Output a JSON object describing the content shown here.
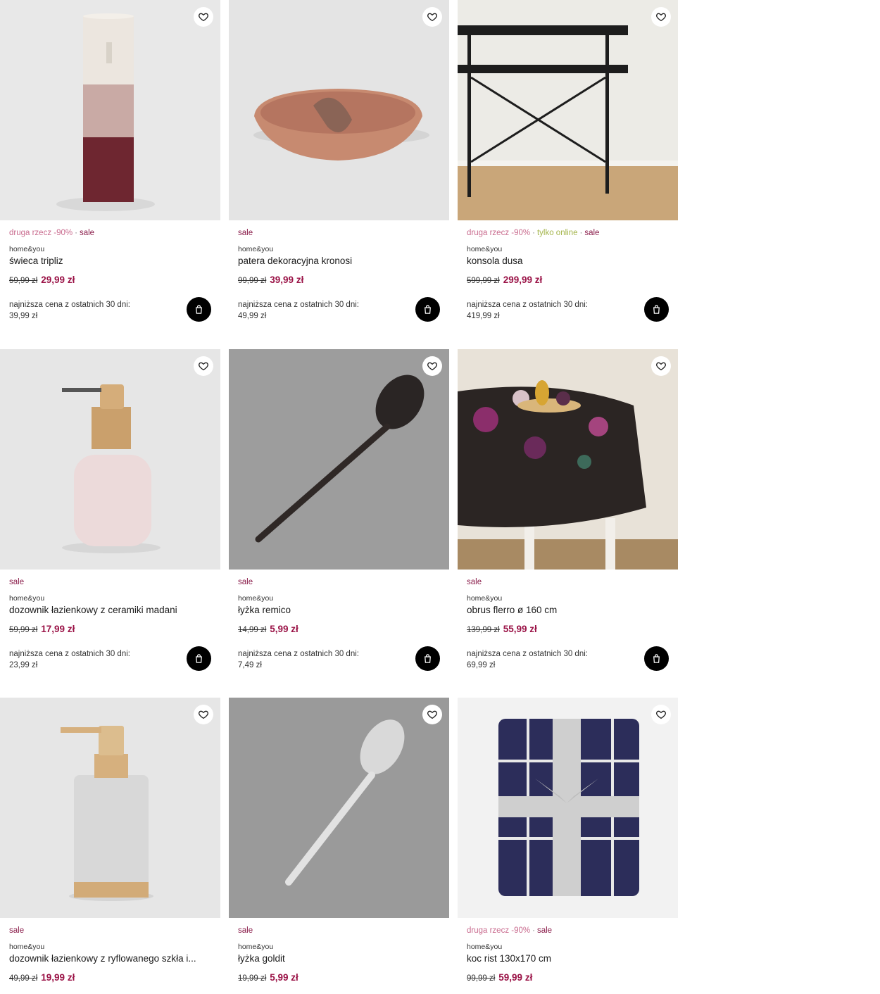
{
  "common": {
    "brand": "home&you",
    "lowest_label": "najniższa cena z ostatnich 30 dni:",
    "sep": "·",
    "colors": {
      "promo": "#c96b8e",
      "online": "#a4b54b",
      "sale": "#8a1c4a",
      "price_new": "#9a1246"
    },
    "icons": {
      "favorite": "heart-outline-icon",
      "cart": "shopping-bag-icon"
    }
  },
  "products": [
    {
      "promo": "druga rzecz -90%",
      "online": "",
      "sale": "sale",
      "brand": "home&you",
      "name": "świeca tripliz",
      "old_price": "59,99 zł",
      "new_price": "29,99 zł",
      "lowest_price": "39,99 zł"
    },
    {
      "promo": "",
      "online": "",
      "sale": "sale",
      "brand": "home&you",
      "name": "patera dekoracyjna kronosi",
      "old_price": "99,99 zł",
      "new_price": "39,99 zł",
      "lowest_price": "49,99 zł"
    },
    {
      "promo": "druga rzecz -90%",
      "online": "tylko online",
      "sale": "sale",
      "brand": "home&you",
      "name": "konsola dusa",
      "old_price": "599,99 zł",
      "new_price": "299,99 zł",
      "lowest_price": "419,99 zł"
    },
    {
      "promo": "",
      "online": "",
      "sale": "sale",
      "brand": "home&you",
      "name": "dozownik łazienkowy z ceramiki madani",
      "old_price": "59,99 zł",
      "new_price": "17,99 zł",
      "lowest_price": "23,99 zł"
    },
    {
      "promo": "",
      "online": "",
      "sale": "sale",
      "brand": "home&you",
      "name": "łyżka remico",
      "old_price": "14,99 zł",
      "new_price": "5,99 zł",
      "lowest_price": "7,49 zł"
    },
    {
      "promo": "",
      "online": "",
      "sale": "sale",
      "brand": "home&you",
      "name": "obrus flerro ø 160 cm",
      "old_price": "139,99 zł",
      "new_price": "55,99 zł",
      "lowest_price": "69,99 zł"
    },
    {
      "promo": "",
      "online": "",
      "sale": "sale",
      "brand": "home&you",
      "name": "dozownik łazienkowy z ryflowanego szkła i...",
      "old_price": "49,99 zł",
      "new_price": "19,99 zł",
      "lowest_price": ""
    },
    {
      "promo": "",
      "online": "",
      "sale": "sale",
      "brand": "home&you",
      "name": "łyżka goldit",
      "old_price": "19,99 zł",
      "new_price": "5,99 zł",
      "lowest_price": ""
    },
    {
      "promo": "druga rzecz -90%",
      "online": "",
      "sale": "sale",
      "brand": "home&you",
      "name": "koc rist 130x170 cm",
      "old_price": "99,99 zł",
      "new_price": "59,99 zł",
      "lowest_price": ""
    }
  ]
}
